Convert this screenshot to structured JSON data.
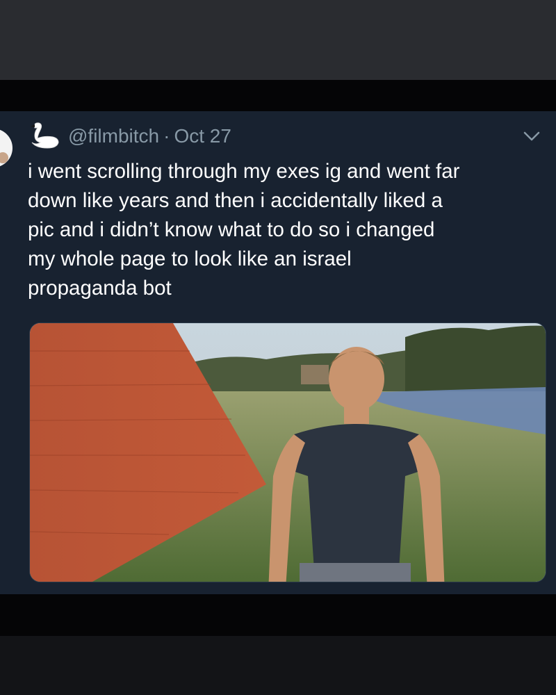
{
  "tweet": {
    "handle": "@filmbitch",
    "separator": "·",
    "date": "Oct 27",
    "text_lines": [
      "i went scrolling through my exes ig and went far",
      "down like years and then i accidentally liked a",
      "pic and i didn’t know what to do so i changed",
      "my whole page to look like an israel",
      "propaganda bot"
    ],
    "avatar_icon": "swan-icon",
    "menu_icon": "chevron-down-icon"
  },
  "colors": {
    "card_background": "#182230",
    "text": "#ffffff",
    "meta_text": "#8899a6"
  }
}
